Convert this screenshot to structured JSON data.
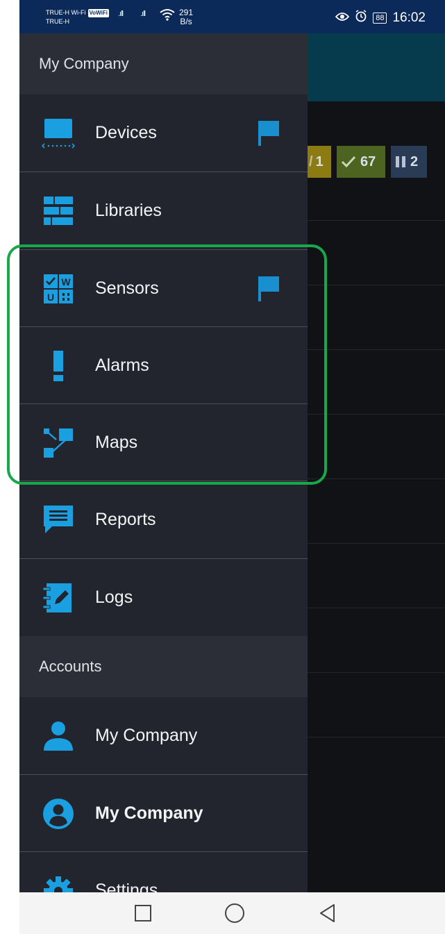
{
  "status_bar": {
    "carrier_line1": "TRUE-H Wi-Fi",
    "volte": "VoWiFi",
    "carrier_line2": "TRUE-H",
    "speed_value": "291",
    "speed_unit": "B/s",
    "battery": "88",
    "time": "16:02",
    "icons": [
      "signal-icon",
      "signal-icon",
      "wifi-icon",
      "eye-icon",
      "alarm-clock-icon",
      "battery-icon"
    ]
  },
  "drawer": {
    "company_header": "My Company",
    "items": [
      {
        "label": "Devices",
        "icon": "monitor-icon",
        "flag": true
      },
      {
        "label": "Libraries",
        "icon": "libraries-icon",
        "flag": false
      },
      {
        "label": "Sensors",
        "icon": "sensors-icon",
        "flag": true
      },
      {
        "label": "Alarms",
        "icon": "exclamation-icon",
        "flag": false
      },
      {
        "label": "Maps",
        "icon": "map-nodes-icon",
        "flag": false
      },
      {
        "label": "Reports",
        "icon": "chat-report-icon",
        "flag": false
      },
      {
        "label": "Logs",
        "icon": "log-edit-icon",
        "flag": false
      }
    ],
    "accounts_header": "Accounts",
    "accounts": [
      {
        "label": "My Company",
        "icon": "person-icon",
        "active": false
      },
      {
        "label": "My Company",
        "icon": "person-circle-icon",
        "active": true
      },
      {
        "label": "Settings",
        "icon": "gear-icon",
        "active": false
      }
    ]
  },
  "background_badges": [
    {
      "label": "1",
      "color": "#8c7a13"
    },
    {
      "label": "67",
      "color": "#4d6420"
    },
    {
      "label": "2",
      "color": "#2a3c55"
    }
  ],
  "colors": {
    "drawer_bg": "#22252d",
    "accent_icon": "#1a9fe0",
    "highlight": "#17a84b",
    "status_bar": "#0b2a5a"
  }
}
